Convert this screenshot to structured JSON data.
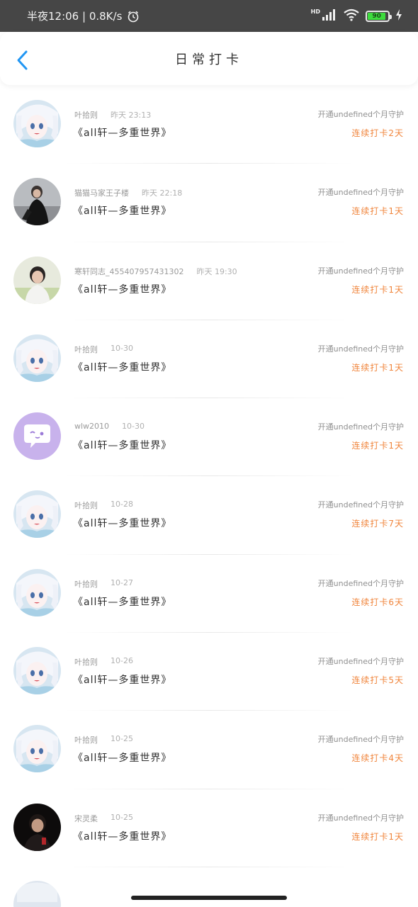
{
  "status_bar": {
    "left_text": "半夜12:06 | 0.8K/s",
    "hd": "HD",
    "battery": "90",
    "battery_level": 0.9
  },
  "header": {
    "title": "日常打卡"
  },
  "records": [
    {
      "user": "叶拾则",
      "time": "昨天 23:13",
      "book": "《all轩—多重世界》",
      "guard": "开通undefined个月守护",
      "streak": "连续打卡2天",
      "avatar": "anime-girl-avatar"
    },
    {
      "user": "猫猫马家王子楼",
      "time": "昨天 22:18",
      "book": "《all轩—多重世界》",
      "guard": "开通undefined个月守护",
      "streak": "连续打卡1天",
      "avatar": "person-black-avatar"
    },
    {
      "user": "寒轩同志_455407957431302",
      "time": "昨天 19:30",
      "book": "《all轩—多重世界》",
      "guard": "开通undefined个月守护",
      "streak": "连续打卡1天",
      "avatar": "person-outdoor-avatar"
    },
    {
      "user": "叶拾则",
      "time": "10-30",
      "book": "《all轩—多重世界》",
      "guard": "开通undefined个月守护",
      "streak": "连续打卡1天",
      "avatar": "anime-girl-avatar"
    },
    {
      "user": "wlw2010",
      "time": "10-30",
      "book": "《all轩—多重世界》",
      "guard": "开通undefined个月守护",
      "streak": "连续打卡1天",
      "avatar": "chat-bubble-avatar"
    },
    {
      "user": "叶拾则",
      "time": "10-28",
      "book": "《all轩—多重世界》",
      "guard": "开通undefined个月守护",
      "streak": "连续打卡7天",
      "avatar": "anime-girl-avatar"
    },
    {
      "user": "叶拾则",
      "time": "10-27",
      "book": "《all轩—多重世界》",
      "guard": "开通undefined个月守护",
      "streak": "连续打卡6天",
      "avatar": "anime-girl-avatar"
    },
    {
      "user": "叶拾则",
      "time": "10-26",
      "book": "《all轩—多重世界》",
      "guard": "开通undefined个月守护",
      "streak": "连续打卡5天",
      "avatar": "anime-girl-avatar"
    },
    {
      "user": "叶拾则",
      "time": "10-25",
      "book": "《all轩—多重世界》",
      "guard": "开通undefined个月守护",
      "streak": "连续打卡4天",
      "avatar": "anime-girl-avatar"
    },
    {
      "user": "宋灵柔",
      "time": "10-25",
      "book": "《all轩—多重世界》",
      "guard": "开通undefined个月守护",
      "streak": "连续打卡1天",
      "avatar": "person-dark-avatar"
    }
  ],
  "colors": {
    "accent": "#2196f3",
    "streak": "#f0853c",
    "status_bar": "#464646"
  }
}
